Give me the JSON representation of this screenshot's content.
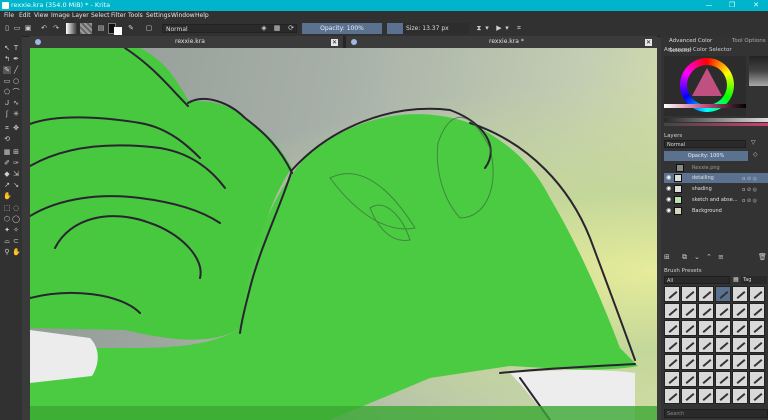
{
  "window": {
    "title": "rexxie.kra (354.0 MiB)  * - Krita",
    "controls": [
      "—",
      "❐",
      "✕"
    ]
  },
  "menu": [
    "File",
    "Edit",
    "View",
    "Image",
    "Layer",
    "Select",
    "Filter",
    "Tools",
    "Settings",
    "Window",
    "Help"
  ],
  "toolbar": {
    "blend_mode": "Normal",
    "opacity": "Opacity: 100%",
    "size": "Size: 13.37 px"
  },
  "tabs": [
    {
      "label": "rexxie.kra"
    },
    {
      "label": "rexxie.kra *"
    }
  ],
  "dock": {
    "tabs": [
      "Advanced Color Selector",
      "Tool Options"
    ],
    "color_selector_title": "Advanced Color Selector",
    "layers_title": "Layers",
    "layers_blend": "Normal",
    "layers_opacity": "Opacity:  100%",
    "layers": [
      {
        "name": "Rexxie.png",
        "selected": false,
        "dim": true
      },
      {
        "name": "detailing",
        "selected": true,
        "dim": false
      },
      {
        "name": "shading",
        "selected": false,
        "dim": false
      },
      {
        "name": "sketch and abse...",
        "selected": false,
        "dim": false
      },
      {
        "name": "Background",
        "selected": false,
        "dim": false
      }
    ],
    "brush_presets_title": "Brush Presets",
    "brush_filter": "All",
    "brush_tag": "Tag",
    "search_placeholder": "Search"
  },
  "colors": {
    "accent": "#00b4cc",
    "selection": "#5a7290",
    "green": "#46c93e"
  }
}
